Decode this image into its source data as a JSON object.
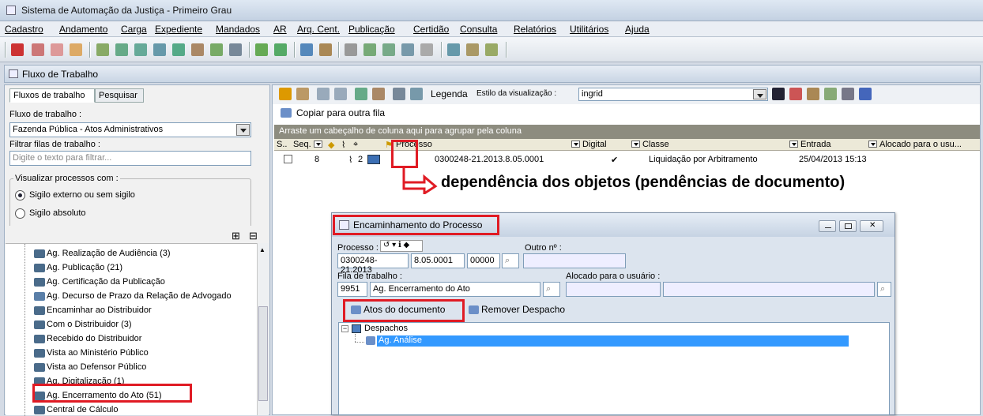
{
  "app": {
    "title": "Sistema de Automação da Justiça - Primeiro Grau"
  },
  "menu": [
    "Cadastro",
    "Andamento",
    "Carga",
    "Expediente",
    "Mandados",
    "AR",
    "Arq. Cent.",
    "Publicação",
    "Certidão",
    "Consulta",
    "Relatórios",
    "Utilitários",
    "Ajuda"
  ],
  "fluxo_header": "Fluxo de Trabalho",
  "left": {
    "tabs": [
      "Fluxos de trabalho",
      "Pesquisar"
    ],
    "fluxo_label": "Fluxo de trabalho :",
    "fluxo_value": "Fazenda Pública - Atos Administrativos",
    "filtrar_label": "Filtrar filas de trabalho :",
    "filtrar_placeholder": "Digite o texto para filtrar...",
    "visualizar_label": "Visualizar processos com :",
    "radio1": "Sigilo externo ou sem sigilo",
    "radio2": "Sigilo absoluto",
    "tree": [
      "Ag. Realização de Audiência (3)",
      "Ag. Publicação (21)",
      "Ag. Certificação da Publicação",
      "Ag. Decurso de Prazo da Relação de Advogado",
      "Encaminhar ao Distribuidor",
      "Com o Distribuidor (3)",
      "Recebido do Distribuidor",
      "Vista ao Ministério Público",
      "Vista ao Defensor Público",
      "Ag. Digitalização (1)",
      "Ag. Encerramento do Ato (51)",
      "Central de Cálculo"
    ]
  },
  "right": {
    "legenda": "Legenda",
    "estilo_label": "Estilo da visualização :",
    "estilo_value": "ingrid",
    "copiar": "Copiar para outra fila",
    "groupbar": "Arraste um cabeçalho de coluna aqui para agrupar pela coluna",
    "cols": {
      "s": "S..",
      "seq": "Seq.",
      "processo": "Processo",
      "digital": "Digital",
      "classe": "Classe",
      "entrada": "Entrada",
      "alocado": "Alocado para o usu..."
    },
    "row": {
      "seq": "8",
      "num": "2",
      "processo": "0300248-21.2013.8.05.0001",
      "classe": "Liquidação por Arbitramento",
      "entrada": "25/04/2013 15:13"
    }
  },
  "callout": "dependência dos objetos (pendências de documento)",
  "dialog": {
    "title": "Encaminhamento do Processo",
    "processo_label": "Processo :",
    "outro_label": "Outro nº :",
    "proc1": "0300248-21.2013",
    "proc2": "8.05.0001",
    "proc3": "00000",
    "fila_label": "Fila de trabalho :",
    "alocado_label": "Alocado para o usuário :",
    "fila_code": "9951",
    "fila_name": "Ag. Encerramento do Ato",
    "atos": "Atos do documento",
    "remover": "Remover Despacho",
    "tree_root": "Despachos",
    "tree_child": "Ag. Análise"
  },
  "colors": {
    "accent": "#e01b24",
    "selection": "#3399ff"
  }
}
